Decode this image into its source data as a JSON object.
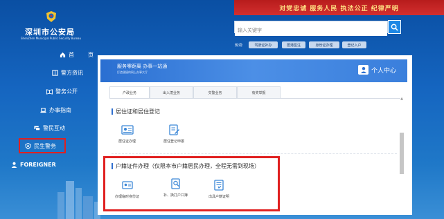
{
  "site": {
    "title": "深圳市公安局",
    "subtitle": "ShenZhen Municipal Public Security Bureau"
  },
  "sidebar": {
    "items": [
      {
        "label": "首",
        "label2": "页",
        "icon": "home-icon"
      },
      {
        "label": "警方资讯",
        "icon": "book-icon"
      },
      {
        "label": "警务公开",
        "icon": "open-book-icon"
      },
      {
        "label": "办事指南",
        "icon": "laptop-icon"
      },
      {
        "label": "警民互动",
        "icon": "chat-icon"
      },
      {
        "label": "民生警务",
        "icon": "police-badge-icon"
      },
      {
        "label": "FOREIGNER",
        "icon": "person-icon"
      }
    ]
  },
  "banner": {
    "slogan": "对党忠诚  服务人民  执法公正  纪律严明"
  },
  "search": {
    "placeholder": "输入关键字",
    "hot_label": "热词：",
    "hot_tags": [
      "驾驶证补办",
      "居港签注",
      "身份证办理",
      "登记入户"
    ]
  },
  "service": {
    "tagline": "服务零距离 办事一站通",
    "sub": "打造便捷的网上办事大厅",
    "user_center": "个人中心"
  },
  "tabs": [
    {
      "label": "户政业务"
    },
    {
      "label": "出入境业务"
    },
    {
      "label": "交警业务"
    },
    {
      "label": "有奖举报"
    }
  ],
  "sections": [
    {
      "title": "居住证和居住登记",
      "items": [
        {
          "label": "居住证办理",
          "icon": "id-card-icon"
        },
        {
          "label": "居住登记申报",
          "icon": "document-edit-icon"
        }
      ]
    },
    {
      "title": "户籍证件办理（仅限本市户籍居民办理，全程无需到现场）",
      "items": [
        {
          "label": "办理临时身份证",
          "icon": "temp-id-icon"
        },
        {
          "label": "补、换打户口簿",
          "icon": "search-document-icon"
        },
        {
          "label": "出具户籍证明",
          "icon": "certificate-icon"
        }
      ]
    }
  ],
  "colors": {
    "accent": "#1e88e5",
    "highlight": "#e02020",
    "slogan_bg": "#c62828",
    "slogan_text": "#ffe082"
  }
}
